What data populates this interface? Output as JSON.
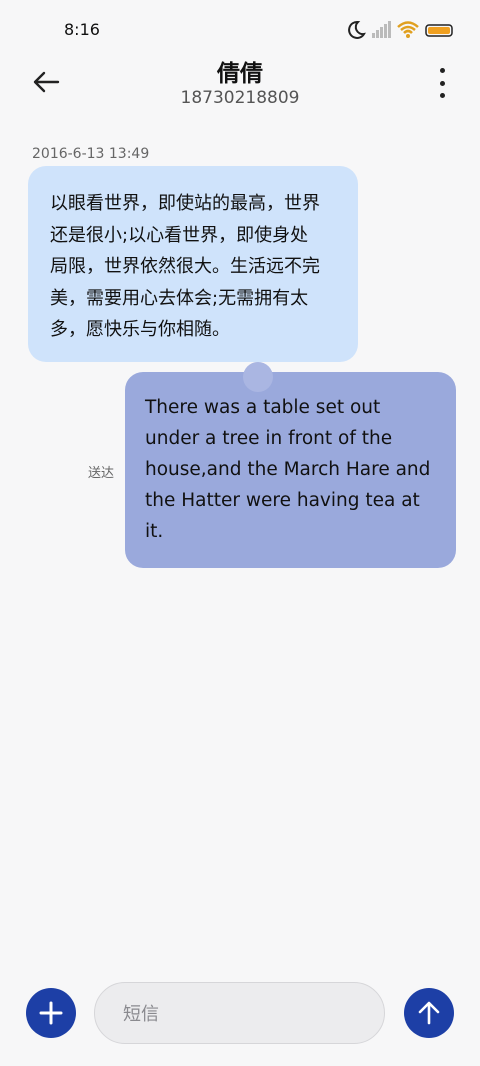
{
  "status_bar": {
    "time": "8:16",
    "icons": [
      "moon-icon",
      "signal-icon",
      "wifi-icon",
      "battery-icon"
    ]
  },
  "header": {
    "title": "倩倩",
    "subtitle": "18730218809",
    "back_icon": "back-arrow-icon",
    "more_icon": "more-vertical-icon"
  },
  "messages": [
    {
      "direction": "incoming",
      "timestamp": "2016-6-13 13:49",
      "lines": [
        "以眼看世界，即使站的最高，世界",
        "还是很小;以心看世界，即使身处",
        "局限，世界依然很大。生活远不完",
        "美，需要用心去体会;无需拥有太",
        "多，愿快乐与你相随。"
      ]
    },
    {
      "direction": "outgoing",
      "status": "送达",
      "lines": [
        "There was a table set out",
        "under a tree in front of the",
        "house,and the March Hare and",
        "the Hatter were having tea at",
        "it."
      ]
    }
  ],
  "composer": {
    "placeholder": "短信",
    "add_icon": "plus-icon",
    "send_icon": "arrow-up-icon"
  },
  "colors": {
    "incoming_bubble": "#cfe3fb",
    "outgoing_bubble": "#9aa9dc",
    "accent": "#1d3fa6",
    "background": "#f7f7f8"
  }
}
